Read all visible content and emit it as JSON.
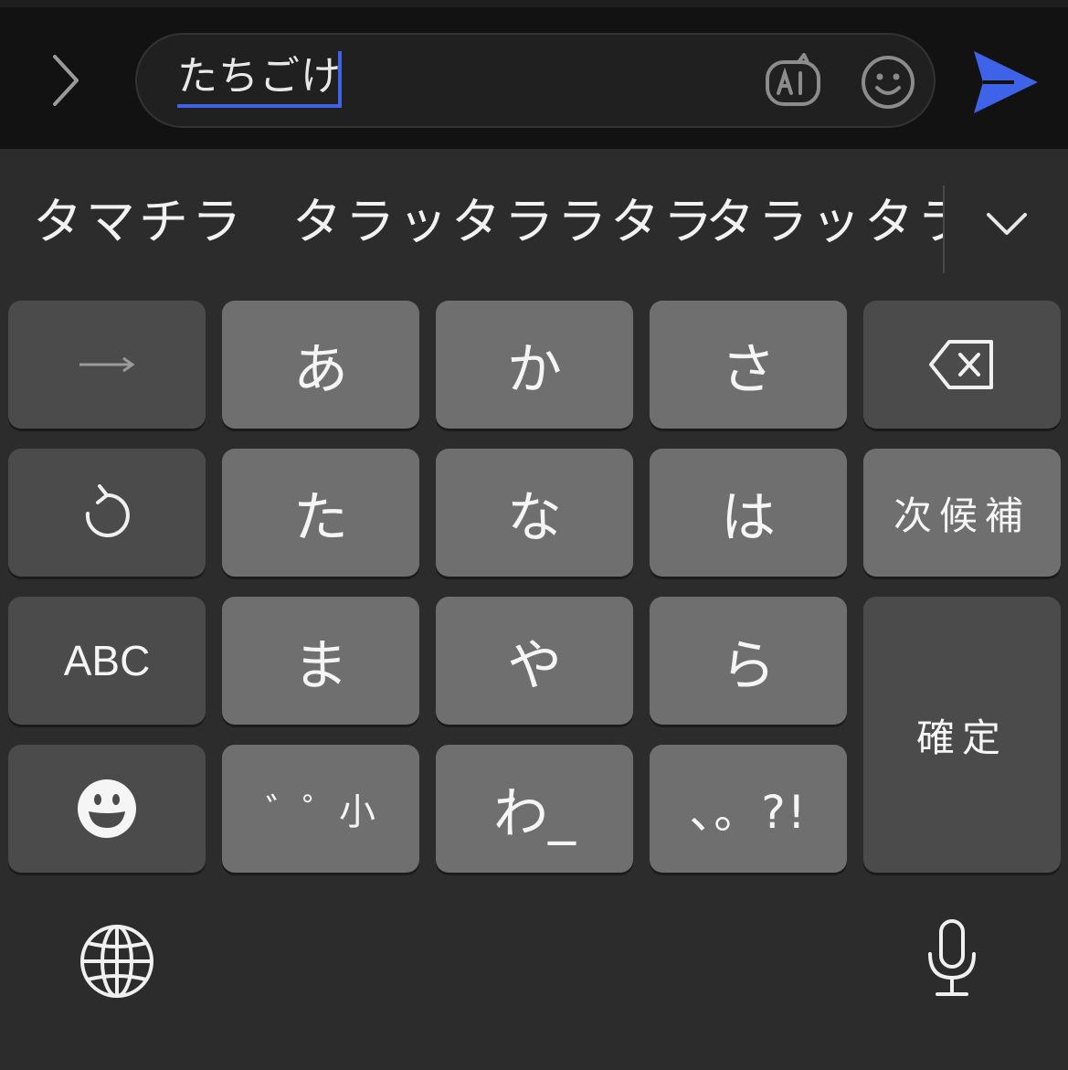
{
  "input": {
    "text": "たちごけ"
  },
  "candidates": [
    "タマチラ",
    "タラッタララタラ",
    "タラッタラ"
  ],
  "keys": {
    "row1": {
      "a": "あ",
      "ka": "か",
      "sa": "さ"
    },
    "row2": {
      "ta": "た",
      "na": "な",
      "ha": "は",
      "next": "次候補"
    },
    "row3": {
      "abc": "ABC",
      "ma": "ま",
      "ya": "や",
      "ra": "ら",
      "confirm": "確定"
    },
    "row4": {
      "dakuten_small": "゛゜小",
      "wa": "わ_",
      "punct": "、。?!"
    }
  },
  "colors": {
    "accent": "#3f63e8",
    "key_light": "#6f6f6f",
    "key_dark": "#4b4b4b",
    "background": "#2c2c2c"
  },
  "icons": [
    "chevron-right-icon",
    "ai-icon",
    "emoji-icon",
    "send-icon",
    "chevron-down-icon",
    "arrow-right-icon",
    "backspace-icon",
    "undo-icon",
    "emoji-face-icon",
    "globe-icon",
    "microphone-icon"
  ]
}
